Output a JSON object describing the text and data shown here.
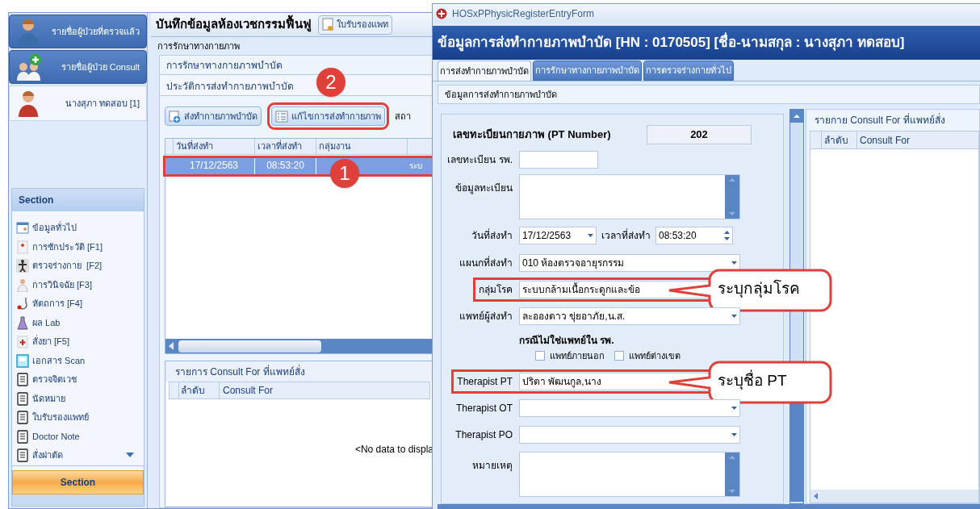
{
  "sidebar": {
    "nav": [
      {
        "label": "รายชื่อผู้ป่วยที่ตรวจแล้ว",
        "kind": "doctor",
        "selected": false
      },
      {
        "label": "รายชื่อผู้ป่วย Consult",
        "kind": "consult",
        "selected": false
      },
      {
        "label": "นางสุภา ทดสอบ [1]",
        "kind": "patient",
        "selected": true
      }
    ],
    "section_title": "Section",
    "section_items": [
      {
        "label": "ข้อมูลทั่วไป",
        "kind": "calendar"
      },
      {
        "label": "การซักประวัติ [F1]",
        "kind": "clipboard"
      },
      {
        "label": "ตรวจร่างกาย  [F2]",
        "kind": "body"
      },
      {
        "label": "การวินิจฉัย [F3]",
        "kind": "person"
      },
      {
        "label": "หัตถการ [F4]",
        "kind": "stethoscope"
      },
      {
        "label": "ผล Lab",
        "kind": "flask"
      },
      {
        "label": "สั่งยา [F5]",
        "kind": "medicine"
      },
      {
        "label": "เอกสาร Scan",
        "kind": "scan"
      },
      {
        "label": "ตรวจจิตเวช",
        "kind": "list"
      },
      {
        "label": "นัดหมาย",
        "kind": "list"
      },
      {
        "label": "ใบรับรองแพทย์",
        "kind": "list"
      },
      {
        "label": "Doctor Note",
        "kind": "list"
      },
      {
        "label": "สั่งผ่าตัด",
        "kind": "list"
      }
    ],
    "section_button": "Section"
  },
  "main": {
    "title": "บันทึกข้อมูลห้องเวชกรรมฟื้นฟู",
    "title_button": "ใบรับรองแพท",
    "subtitle": "การรักษาทางกายภาพ",
    "group_title": "การรักษาทางกายภาพบำบัด",
    "history_title": "ประวัติการส่งทำกายภาพบำบัด",
    "buttons": [
      {
        "label": "ส่งทำกายภาพบำบัด",
        "kind": "add",
        "highlighted": false
      },
      {
        "label": "แก้ไขการส่งทำกายภาพ",
        "kind": "edit",
        "highlighted": true,
        "badge": "2"
      }
    ],
    "toolbar_text": "สถา",
    "columns": [
      "วันที่ส่งทำ",
      "เวลาที่ส่งทำ",
      "กลุ่มงาน"
    ],
    "rows": [
      {
        "date": "17/12/2563",
        "time": "08:53:20",
        "column_4": "ระบ",
        "selected": true,
        "highlighted": true,
        "badge": "1"
      }
    ],
    "consult_title": "รายการ Consult For ที่แพทย์สั่ง",
    "consult_columns": [
      "ลำดับ",
      "Consult For"
    ],
    "consult_empty": "<No data to displa"
  },
  "dialog": {
    "window_title": "HOSxPPhysicRegisterEntryForm",
    "heading": "ข้อมูลการส่งทำกายภาพบำบัด [HN : 0170505] [ชื่อ-นามสกุล : นางสุภา ทดสอบ]",
    "tabs": [
      {
        "label": "การส่งทำกายภาพบำบัด",
        "selected": true
      },
      {
        "label": "การรักษาทางกายภาพบำบัด",
        "selected": false
      },
      {
        "label": "การตรวจร่างกายทั่วไป",
        "selected": false
      }
    ],
    "section_title": "ข้อมูลการส่งทำกายภาพบำบัด",
    "pt_number_label": "เลขทะเบียนกายภาพ (PT Number)",
    "pt_number": "202",
    "fields": [
      {
        "kind": "short",
        "label": "เลขทะเบียน รพ."
      },
      {
        "kind": "memo",
        "label": "ข้อมูลทะเบียน"
      },
      {
        "kind": "datetime",
        "label": "วันที่ส่งทำ",
        "value": "17/12/2563",
        "time_label": "เวลาที่ส่งทำ",
        "time": "08:53:20"
      },
      {
        "kind": "combo",
        "label": "แผนกที่ส่งทำ",
        "value": "010 ห้องตรวจอายุรกรรม"
      },
      {
        "kind": "combo",
        "label": "กลุ่มโรค",
        "value": "ระบบกล้ามเนื้อกระดูกและข้อ",
        "highlighted": true,
        "callout": "ระบุกลุ่มโรค"
      },
      {
        "kind": "combo",
        "label": "แพทย์ผู้ส่งทำ",
        "value": "ละอองดาว ขุ่ยอาภัย,น.ส."
      },
      {
        "kind": "checks",
        "label": "กรณีไม่ใช่แพทย์ใน รพ.",
        "options": [
          {
            "label": "แพทย์ภายนอก",
            "checked": false
          },
          {
            "label": "แพทย์ต่างเขต",
            "checked": false
          }
        ]
      },
      {
        "kind": "combo",
        "label": "Therapist PT",
        "value": "ปริตา พัฒนกูล,นาง",
        "highlighted": true,
        "callout": "ระบุชื่อ PT"
      },
      {
        "kind": "combo",
        "label": "Therapist OT"
      },
      {
        "kind": "combo",
        "label": "Therapist PO"
      },
      {
        "kind": "memo",
        "label": "หมายเหตุ"
      }
    ],
    "consult_title": "รายกาย Consult For ที่แพทย์สั่ง",
    "consult_columns": [
      "ลำดับ",
      "Consult For"
    ]
  }
}
